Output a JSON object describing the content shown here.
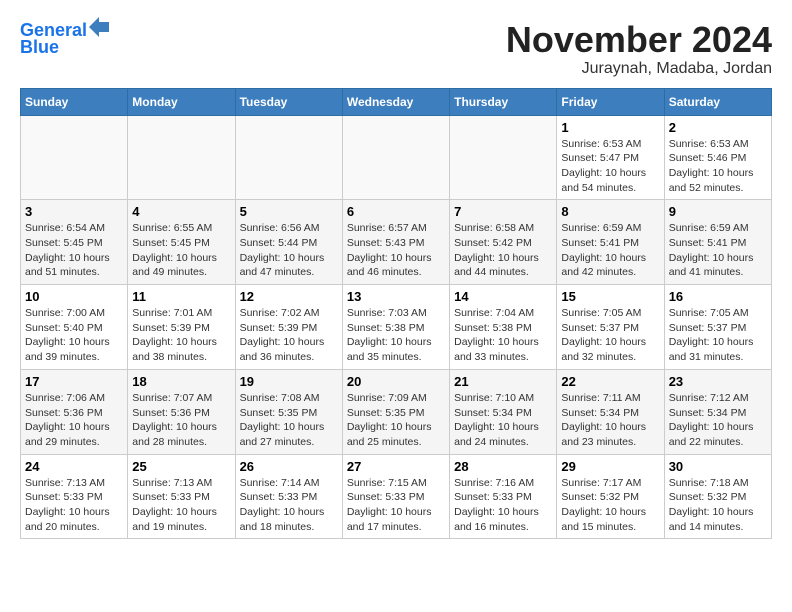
{
  "logo": {
    "line1": "General",
    "line2": "Blue"
  },
  "title": "November 2024",
  "subtitle": "Juraynah, Madaba, Jordan",
  "days_of_week": [
    "Sunday",
    "Monday",
    "Tuesday",
    "Wednesday",
    "Thursday",
    "Friday",
    "Saturday"
  ],
  "weeks": [
    [
      {
        "day": "",
        "info": ""
      },
      {
        "day": "",
        "info": ""
      },
      {
        "day": "",
        "info": ""
      },
      {
        "day": "",
        "info": ""
      },
      {
        "day": "",
        "info": ""
      },
      {
        "day": "1",
        "info": "Sunrise: 6:53 AM\nSunset: 5:47 PM\nDaylight: 10 hours and 54 minutes."
      },
      {
        "day": "2",
        "info": "Sunrise: 6:53 AM\nSunset: 5:46 PM\nDaylight: 10 hours and 52 minutes."
      }
    ],
    [
      {
        "day": "3",
        "info": "Sunrise: 6:54 AM\nSunset: 5:45 PM\nDaylight: 10 hours and 51 minutes."
      },
      {
        "day": "4",
        "info": "Sunrise: 6:55 AM\nSunset: 5:45 PM\nDaylight: 10 hours and 49 minutes."
      },
      {
        "day": "5",
        "info": "Sunrise: 6:56 AM\nSunset: 5:44 PM\nDaylight: 10 hours and 47 minutes."
      },
      {
        "day": "6",
        "info": "Sunrise: 6:57 AM\nSunset: 5:43 PM\nDaylight: 10 hours and 46 minutes."
      },
      {
        "day": "7",
        "info": "Sunrise: 6:58 AM\nSunset: 5:42 PM\nDaylight: 10 hours and 44 minutes."
      },
      {
        "day": "8",
        "info": "Sunrise: 6:59 AM\nSunset: 5:41 PM\nDaylight: 10 hours and 42 minutes."
      },
      {
        "day": "9",
        "info": "Sunrise: 6:59 AM\nSunset: 5:41 PM\nDaylight: 10 hours and 41 minutes."
      }
    ],
    [
      {
        "day": "10",
        "info": "Sunrise: 7:00 AM\nSunset: 5:40 PM\nDaylight: 10 hours and 39 minutes."
      },
      {
        "day": "11",
        "info": "Sunrise: 7:01 AM\nSunset: 5:39 PM\nDaylight: 10 hours and 38 minutes."
      },
      {
        "day": "12",
        "info": "Sunrise: 7:02 AM\nSunset: 5:39 PM\nDaylight: 10 hours and 36 minutes."
      },
      {
        "day": "13",
        "info": "Sunrise: 7:03 AM\nSunset: 5:38 PM\nDaylight: 10 hours and 35 minutes."
      },
      {
        "day": "14",
        "info": "Sunrise: 7:04 AM\nSunset: 5:38 PM\nDaylight: 10 hours and 33 minutes."
      },
      {
        "day": "15",
        "info": "Sunrise: 7:05 AM\nSunset: 5:37 PM\nDaylight: 10 hours and 32 minutes."
      },
      {
        "day": "16",
        "info": "Sunrise: 7:05 AM\nSunset: 5:37 PM\nDaylight: 10 hours and 31 minutes."
      }
    ],
    [
      {
        "day": "17",
        "info": "Sunrise: 7:06 AM\nSunset: 5:36 PM\nDaylight: 10 hours and 29 minutes."
      },
      {
        "day": "18",
        "info": "Sunrise: 7:07 AM\nSunset: 5:36 PM\nDaylight: 10 hours and 28 minutes."
      },
      {
        "day": "19",
        "info": "Sunrise: 7:08 AM\nSunset: 5:35 PM\nDaylight: 10 hours and 27 minutes."
      },
      {
        "day": "20",
        "info": "Sunrise: 7:09 AM\nSunset: 5:35 PM\nDaylight: 10 hours and 25 minutes."
      },
      {
        "day": "21",
        "info": "Sunrise: 7:10 AM\nSunset: 5:34 PM\nDaylight: 10 hours and 24 minutes."
      },
      {
        "day": "22",
        "info": "Sunrise: 7:11 AM\nSunset: 5:34 PM\nDaylight: 10 hours and 23 minutes."
      },
      {
        "day": "23",
        "info": "Sunrise: 7:12 AM\nSunset: 5:34 PM\nDaylight: 10 hours and 22 minutes."
      }
    ],
    [
      {
        "day": "24",
        "info": "Sunrise: 7:13 AM\nSunset: 5:33 PM\nDaylight: 10 hours and 20 minutes."
      },
      {
        "day": "25",
        "info": "Sunrise: 7:13 AM\nSunset: 5:33 PM\nDaylight: 10 hours and 19 minutes."
      },
      {
        "day": "26",
        "info": "Sunrise: 7:14 AM\nSunset: 5:33 PM\nDaylight: 10 hours and 18 minutes."
      },
      {
        "day": "27",
        "info": "Sunrise: 7:15 AM\nSunset: 5:33 PM\nDaylight: 10 hours and 17 minutes."
      },
      {
        "day": "28",
        "info": "Sunrise: 7:16 AM\nSunset: 5:33 PM\nDaylight: 10 hours and 16 minutes."
      },
      {
        "day": "29",
        "info": "Sunrise: 7:17 AM\nSunset: 5:32 PM\nDaylight: 10 hours and 15 minutes."
      },
      {
        "day": "30",
        "info": "Sunrise: 7:18 AM\nSunset: 5:32 PM\nDaylight: 10 hours and 14 minutes."
      }
    ]
  ]
}
